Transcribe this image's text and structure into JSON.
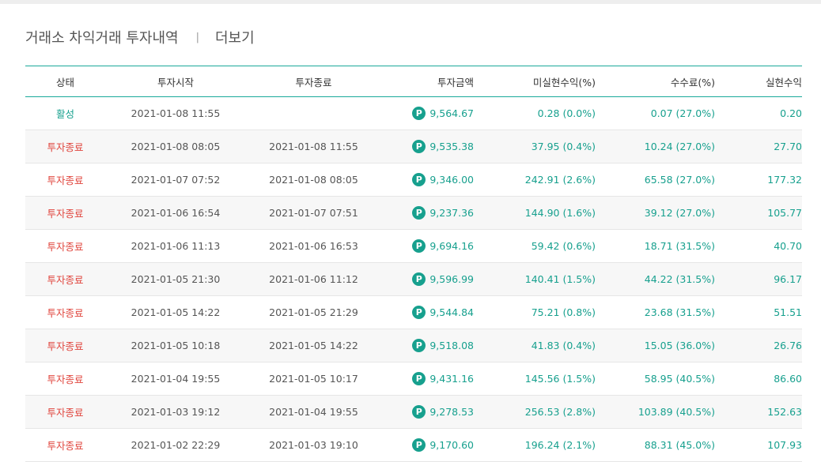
{
  "header": {
    "title": "거래소 차익거래 투자내역",
    "separator": "|",
    "more_label": "더보기"
  },
  "colors": {
    "accent": "#17a08e",
    "ended": "#e0443c",
    "border": "#1aa99a"
  },
  "table": {
    "columns": [
      "상태",
      "투자시작",
      "투자종료",
      "투자금액",
      "미실현수익(%)",
      "수수료(%)",
      "실현수익"
    ],
    "point_icon": "P",
    "rows": [
      {
        "status": "활성",
        "start": "2021-01-08 11:55",
        "end": "",
        "amount": "9,564.67",
        "unrealized": "0.28 (0.0%)",
        "fee": "0.07 (27.0%)",
        "realized": "0.20"
      },
      {
        "status": "투자종료",
        "start": "2021-01-08 08:05",
        "end": "2021-01-08 11:55",
        "amount": "9,535.38",
        "unrealized": "37.95 (0.4%)",
        "fee": "10.24 (27.0%)",
        "realized": "27.70"
      },
      {
        "status": "투자종료",
        "start": "2021-01-07 07:52",
        "end": "2021-01-08 08:05",
        "amount": "9,346.00",
        "unrealized": "242.91 (2.6%)",
        "fee": "65.58 (27.0%)",
        "realized": "177.32"
      },
      {
        "status": "투자종료",
        "start": "2021-01-06 16:54",
        "end": "2021-01-07 07:51",
        "amount": "9,237.36",
        "unrealized": "144.90 (1.6%)",
        "fee": "39.12 (27.0%)",
        "realized": "105.77"
      },
      {
        "status": "투자종료",
        "start": "2021-01-06 11:13",
        "end": "2021-01-06 16:53",
        "amount": "9,694.16",
        "unrealized": "59.42 (0.6%)",
        "fee": "18.71 (31.5%)",
        "realized": "40.70"
      },
      {
        "status": "투자종료",
        "start": "2021-01-05 21:30",
        "end": "2021-01-06 11:12",
        "amount": "9,596.99",
        "unrealized": "140.41 (1.5%)",
        "fee": "44.22 (31.5%)",
        "realized": "96.17"
      },
      {
        "status": "투자종료",
        "start": "2021-01-05 14:22",
        "end": "2021-01-05 21:29",
        "amount": "9,544.84",
        "unrealized": "75.21 (0.8%)",
        "fee": "23.68 (31.5%)",
        "realized": "51.51"
      },
      {
        "status": "투자종료",
        "start": "2021-01-05 10:18",
        "end": "2021-01-05 14:22",
        "amount": "9,518.08",
        "unrealized": "41.83 (0.4%)",
        "fee": "15.05 (36.0%)",
        "realized": "26.76"
      },
      {
        "status": "투자종료",
        "start": "2021-01-04 19:55",
        "end": "2021-01-05 10:17",
        "amount": "9,431.16",
        "unrealized": "145.56 (1.5%)",
        "fee": "58.95 (40.5%)",
        "realized": "86.60"
      },
      {
        "status": "투자종료",
        "start": "2021-01-03 19:12",
        "end": "2021-01-04 19:55",
        "amount": "9,278.53",
        "unrealized": "256.53 (2.8%)",
        "fee": "103.89 (40.5%)",
        "realized": "152.63"
      },
      {
        "status": "투자종료",
        "start": "2021-01-02 22:29",
        "end": "2021-01-03 19:10",
        "amount": "9,170.60",
        "unrealized": "196.24 (2.1%)",
        "fee": "88.31 (45.0%)",
        "realized": "107.93"
      }
    ]
  }
}
